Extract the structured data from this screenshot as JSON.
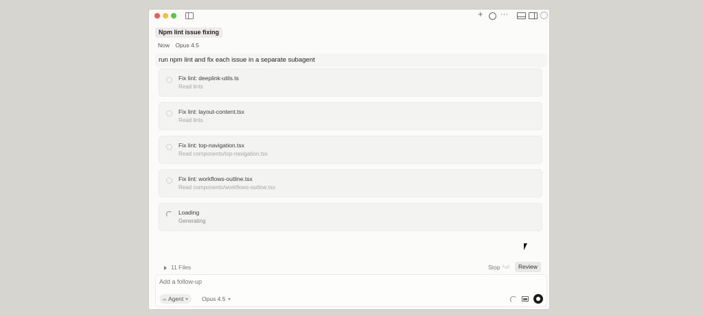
{
  "chat": {
    "title": "Npm lint issue fixing",
    "time": "Now",
    "model": "Opus 4.5"
  },
  "prompt": "run npm lint and fix each issue in a separate subagent",
  "tasks": [
    {
      "title": "Fix lint: deeplink-utils.ts",
      "status": "Read lints"
    },
    {
      "title": "Fix lint: layout-content.tsx",
      "status": "Read lints"
    },
    {
      "title": "Fix lint: top-navigation.tsx",
      "status": "Read components/top-navigation.tsx"
    },
    {
      "title": "Fix lint: workflows-outline.tsx",
      "status": "Read components/workflows-outline.tsx"
    },
    {
      "title": "Loading",
      "status": "Generating"
    }
  ],
  "footer": {
    "files": "11 Files",
    "stop": "Stop",
    "stop_shortcut": "^⏎",
    "review": "Review"
  },
  "composer": {
    "placeholder": "Add a follow-up",
    "agent_icon": "∞",
    "agent_label": "Agent",
    "model_label": "Opus 4.5"
  }
}
